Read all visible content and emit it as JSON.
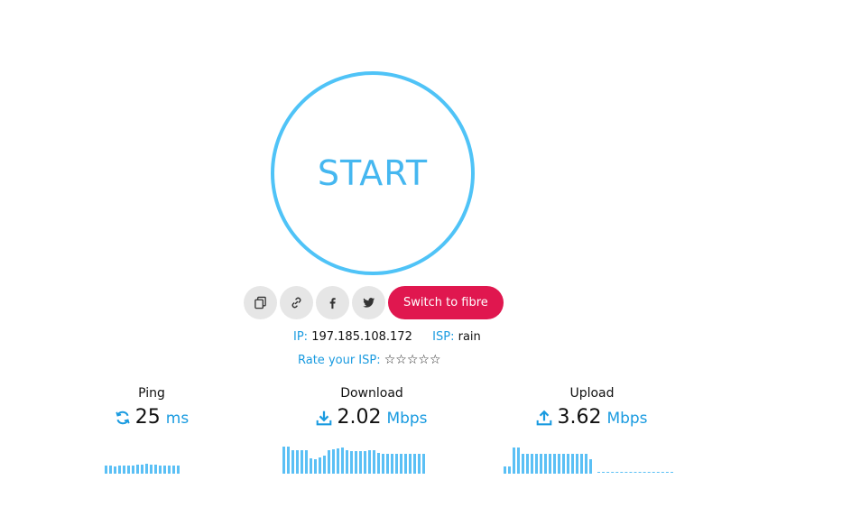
{
  "start": {
    "label": "START"
  },
  "share": {
    "icons": [
      "copy-icon",
      "link-icon",
      "facebook-icon",
      "twitter-icon"
    ],
    "fibre_label": "Switch to fibre"
  },
  "info": {
    "ip_label": "IP:",
    "ip_value": "197.185.108.172",
    "isp_label": "ISP:",
    "isp_value": "rain"
  },
  "rate": {
    "label": "Rate your ISP:",
    "stars": "☆☆☆☆☆"
  },
  "metrics": {
    "ping": {
      "label": "Ping",
      "value": "25",
      "unit": "ms"
    },
    "download": {
      "label": "Download",
      "value": "2.02",
      "unit": "Mbps"
    },
    "upload": {
      "label": "Upload",
      "value": "3.62",
      "unit": "Mbps"
    }
  },
  "colors": {
    "accent": "#4fc3f7",
    "fibre_button": "#e0174f",
    "unit_text": "#1a9be0"
  },
  "graphs": {
    "ping_bars": [
      9,
      9,
      8,
      9,
      9,
      9,
      9,
      10,
      10,
      11,
      10,
      10,
      9,
      9,
      9,
      9,
      9
    ],
    "download_bars": [
      30,
      30,
      26,
      26,
      26,
      26,
      17,
      16,
      18,
      20,
      26,
      27,
      28,
      29,
      26,
      25,
      25,
      25,
      25,
      26,
      26,
      23,
      22,
      22,
      22,
      22,
      22,
      22,
      22,
      22,
      22,
      22
    ],
    "upload_bars": [
      8,
      8,
      29,
      29,
      22,
      22,
      22,
      22,
      22,
      22,
      22,
      22,
      22,
      22,
      22,
      22,
      22,
      22,
      22,
      16
    ]
  }
}
